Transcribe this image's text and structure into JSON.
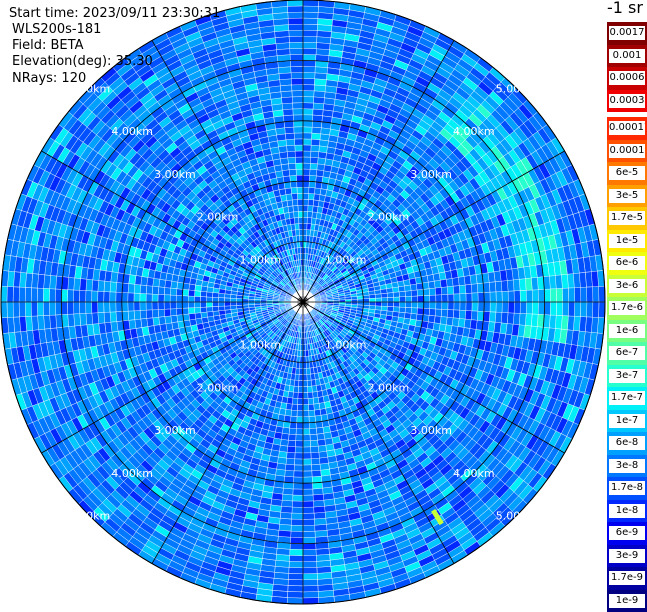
{
  "info": {
    "start_time": "Start time: 2023/09/11 23:30:31",
    "device": "WLS200s-181",
    "field": "Field: BETA",
    "elevation": "Elevation(deg): 35.30",
    "nrays": "NRays: 120"
  },
  "colorbar": {
    "title": "-1 sr",
    "labels_top": [
      "0.0017",
      "0.001",
      "0.0006",
      "0.0003"
    ],
    "labels_bottom": [
      "0.00017",
      "0.0001",
      "6e-5",
      "3e-5",
      "1.7e-5",
      "1e-5",
      "6e-6",
      "3e-6",
      "1.7e-6",
      "1e-6",
      "6e-7",
      "3e-7",
      "1.7e-7",
      "1e-7",
      "6e-8",
      "3e-8",
      "1.7e-8",
      "1e-8",
      "6e-9",
      "3e-9",
      "1.7e-9",
      "1e-9"
    ],
    "colors_top": [
      "#800000",
      "#a00000",
      "#c80000",
      "#f00000"
    ],
    "colors_bottom": [
      "#ff2800",
      "#ff5000",
      "#ff7800",
      "#ffa000",
      "#ffc800",
      "#ffea00",
      "#f0ff10",
      "#c8ff36",
      "#a0ff5c",
      "#78ff82",
      "#50ffa8",
      "#28ffce",
      "#00f0f8",
      "#00c8ff",
      "#00a0ff",
      "#0078ff",
      "#0050ff",
      "#0028ff",
      "#0000f0",
      "#0000c8",
      "#0000a0",
      "#000080"
    ]
  },
  "chart_data": {
    "type": "heatmap",
    "projection": "polar (PPI scan)",
    "field": "BETA",
    "unit": "-1 sr",
    "elevation_deg": 35.3,
    "n_rays": 120,
    "range_rings_km": [
      1.0,
      2.0,
      3.0,
      4.0,
      5.0
    ],
    "range_ring_labels": [
      "1.00km",
      "2.00km",
      "3.00km",
      "4.00km",
      "5.00km"
    ],
    "max_range_km": 5.0,
    "grid_azimuth_step_deg": 30,
    "color_scale": "log",
    "color_range": [
      1e-09,
      0.0017
    ],
    "dominant_value_range": [
      1e-08,
      1e-07
    ],
    "enhanced_features": [
      {
        "description": "stronger arc",
        "azimuth_deg_range": [
          40,
          100
        ],
        "range_km": [
          3.6,
          4.4
        ],
        "approx_value": 1.7e-07
      },
      {
        "description": "spot",
        "azimuth_deg": 148,
        "range_km": 4.2,
        "approx_value": 3e-06
      }
    ]
  }
}
